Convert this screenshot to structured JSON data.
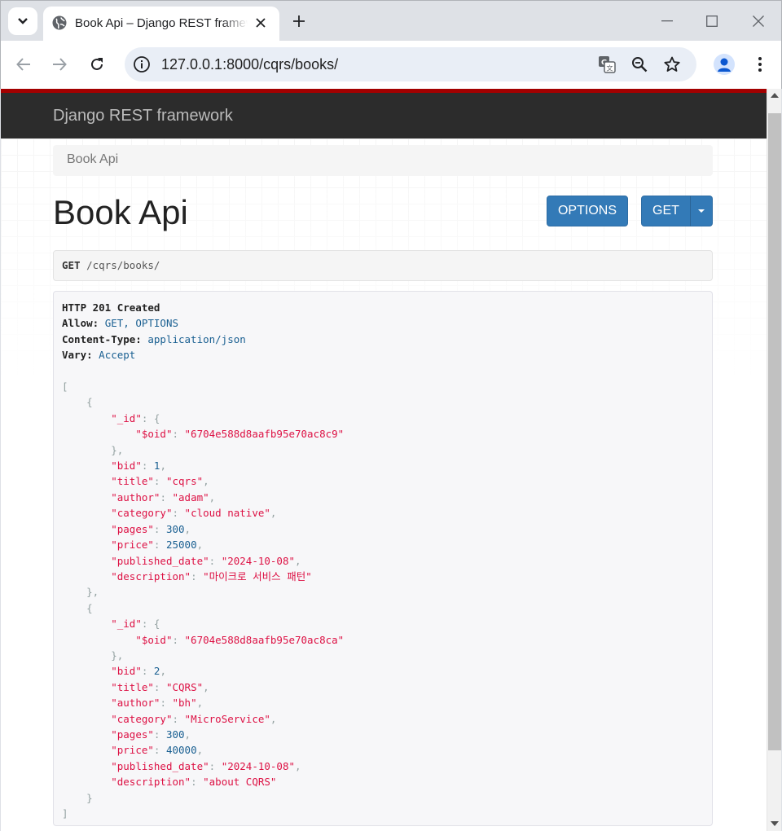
{
  "browser": {
    "tab_title": "Book Api – Django REST framework",
    "url": "127.0.0.1:8000/cqrs/books/"
  },
  "page": {
    "brand": "Django REST framework",
    "breadcrumb": "Book Api",
    "title": "Book Api",
    "options_button": "OPTIONS",
    "get_button": "GET",
    "request_method": "GET",
    "request_path": "/cqrs/books/",
    "response_status": "HTTP 201 Created",
    "headers": [
      {
        "key": "Allow:",
        "value": "GET, OPTIONS"
      },
      {
        "key": "Content-Type:",
        "value": "application/json"
      },
      {
        "key": "Vary:",
        "value": "Accept"
      }
    ],
    "books": [
      {
        "oid": "6704e588d8aafb95e70ac8c9",
        "bid": 1,
        "title": "cqrs",
        "author": "adam",
        "category": "cloud native",
        "pages": 300,
        "price": 25000,
        "published_date": "2024-10-08",
        "description": "마이크로 서비스 패턴"
      },
      {
        "oid": "6704e588d8aafb95e70ac8ca",
        "bid": 2,
        "title": "CQRS",
        "author": "bh",
        "category": "MicroService",
        "pages": 300,
        "price": 40000,
        "published_date": "2024-10-08",
        "description": "about CQRS"
      }
    ]
  },
  "colors": {
    "accent_red": "#a30000",
    "navbar": "#2c2c2c",
    "button_primary": "#337ab7",
    "json_string": "#dd1144",
    "json_number": "#195f91"
  },
  "icons": [
    "tab-search-icon",
    "globe-icon",
    "close-icon",
    "plus-icon",
    "minimize-icon",
    "maximize-icon",
    "back-icon",
    "forward-icon",
    "reload-icon",
    "site-info-icon",
    "translate-icon",
    "zoom-icon",
    "bookmark-star-icon",
    "profile-icon",
    "menu-dots-icon"
  ]
}
